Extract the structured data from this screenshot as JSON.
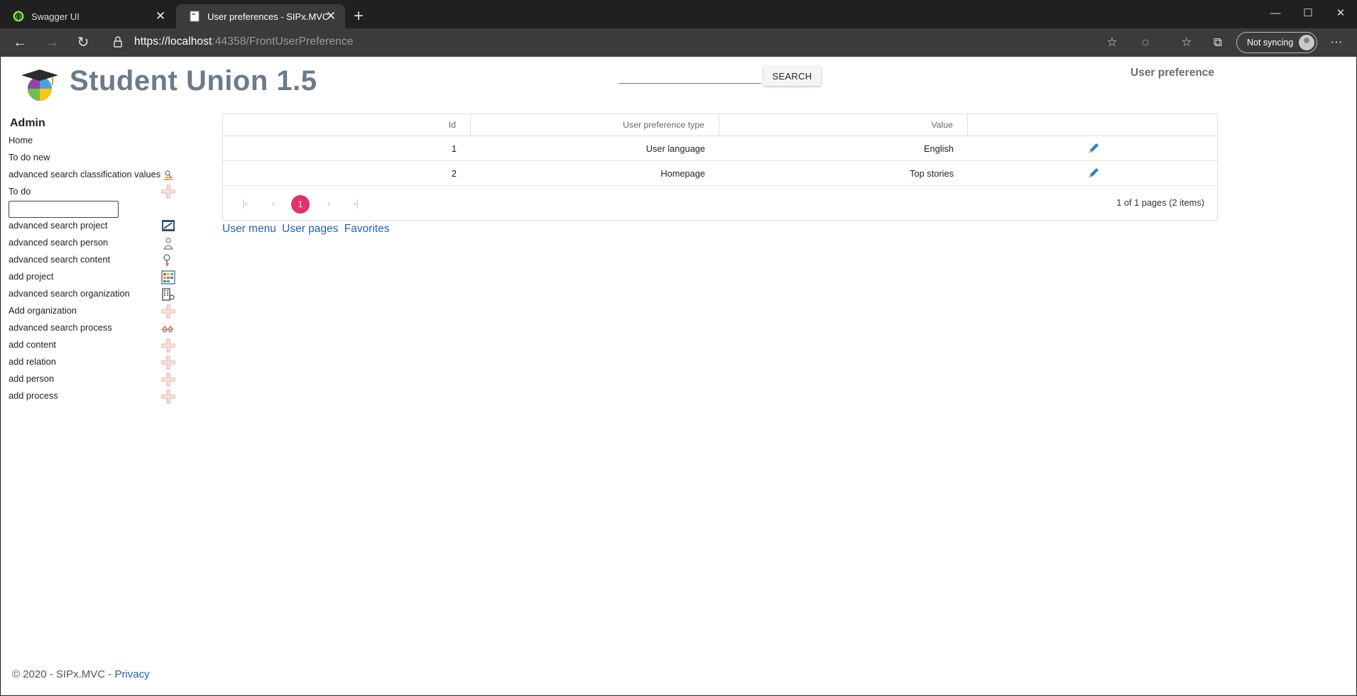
{
  "browser": {
    "tabs": [
      {
        "title": "Swagger UI",
        "active": false
      },
      {
        "title": "User preferences - SIPx.MVC",
        "active": true
      }
    ],
    "url_base": "https://localhost",
    "url_rest": ":44358/FrontUserPreference",
    "sync_label": "Not syncing"
  },
  "header": {
    "app_title": "Student Union 1.5",
    "search_button": "SEARCH",
    "page_heading": "User preference"
  },
  "sidebar": {
    "title": "Admin",
    "items": [
      {
        "label": "Home",
        "icon": null
      },
      {
        "label": "To do new",
        "icon": null
      },
      {
        "label": "advanced search classification values",
        "icon": "classification-search-icon"
      },
      {
        "label": "To do",
        "icon": "plus-icon"
      },
      {
        "label": "advanced search project",
        "icon": "project-search-icon"
      },
      {
        "label": "advanced search person",
        "icon": "person-search-icon"
      },
      {
        "label": "advanced search content",
        "icon": "content-search-icon"
      },
      {
        "label": "add project",
        "icon": "add-project-icon"
      },
      {
        "label": "advanced search organization",
        "icon": "organization-search-icon"
      },
      {
        "label": "Add organization",
        "icon": "plus-icon"
      },
      {
        "label": "advanced search process",
        "icon": "process-search-icon"
      },
      {
        "label": "add content",
        "icon": "plus-icon"
      },
      {
        "label": "add relation",
        "icon": "plus-icon"
      },
      {
        "label": "add person",
        "icon": "plus-icon"
      },
      {
        "label": "add process",
        "icon": "plus-icon"
      }
    ]
  },
  "grid": {
    "columns": [
      "Id",
      "User preference type",
      "Value",
      ""
    ],
    "rows": [
      {
        "id": "1",
        "type": "User language",
        "value": "English"
      },
      {
        "id": "2",
        "type": "Homepage",
        "value": "Top stories"
      }
    ],
    "pager": {
      "current_page": "1",
      "info": "1 of 1 pages (2 items)"
    }
  },
  "links": [
    "User menu",
    "User pages",
    "Favorites"
  ],
  "footer": {
    "text": "© 2020 - SIPx.MVC - ",
    "privacy": "Privacy"
  },
  "colors": {
    "accent": "#e5306a",
    "link": "#1f63b0",
    "title": "#6c7a8d"
  }
}
